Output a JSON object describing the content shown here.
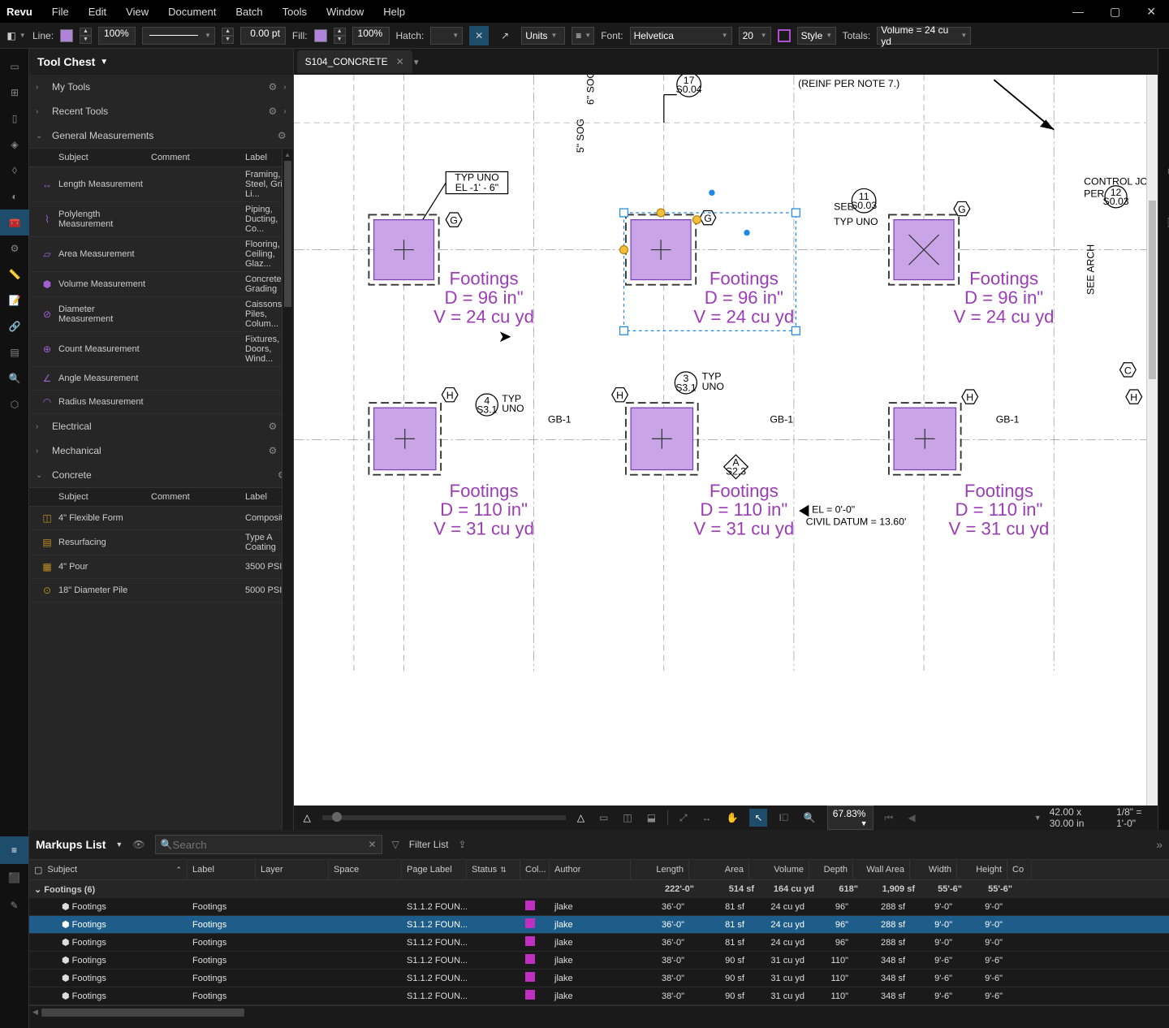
{
  "app": {
    "name": "Revu"
  },
  "menu": [
    "File",
    "Edit",
    "View",
    "Document",
    "Batch",
    "Tools",
    "Window",
    "Help"
  ],
  "toolbar": {
    "line_label": "Line:",
    "line_swatch": "#b083d8",
    "line_pct": "100%",
    "thickness": "0.00 pt",
    "fill_label": "Fill:",
    "fill_swatch": "#b083d8",
    "fill_pct": "100%",
    "hatch_label": "Hatch:",
    "units_label": "Units",
    "font_label": "Font:",
    "font_value": "Helvetica",
    "font_size": "20",
    "style_label": "Style",
    "totals_label": "Totals:",
    "totals_value": "Volume = 24 cu yd"
  },
  "tool_chest": {
    "title": "Tool Chest",
    "sections": {
      "my_tools": "My Tools",
      "recent_tools": "Recent Tools",
      "general": "General Measurements",
      "electrical": "Electrical",
      "mechanical": "Mechanical",
      "concrete": "Concrete"
    },
    "cols": {
      "subject": "Subject",
      "comment": "Comment",
      "label": "Label"
    },
    "general_rows": [
      {
        "subject": "Length Measurement",
        "label": "Framing, Steel, Grid Li..."
      },
      {
        "subject": "Polylength Measurement",
        "label": "Piping, Ducting, Co..."
      },
      {
        "subject": "Area Measurement",
        "label": "Flooring, Ceiling, Glaz..."
      },
      {
        "subject": "Volume Measurement",
        "label": "Concrete, Grading"
      },
      {
        "subject": "Diameter Measurement",
        "label": "Caissons, Piles, Colum..."
      },
      {
        "subject": "Count Measurement",
        "label": "Fixtures, Doors, Wind..."
      },
      {
        "subject": "Angle Measurement",
        "label": ""
      },
      {
        "subject": "Radius Measurement",
        "label": ""
      }
    ],
    "concrete_rows": [
      {
        "subject": "4\" Flexible Form",
        "label": "Composite"
      },
      {
        "subject": "Resurfacing",
        "label": "Type A Coating"
      },
      {
        "subject": "4\" Pour",
        "label": "3500 PSI"
      },
      {
        "subject": "18\" Diameter Pile",
        "label": "5000 PSI"
      }
    ]
  },
  "document": {
    "tab_name": "S104_CONCRETE",
    "reinf_note": "(REINF PER NOTE 7.)",
    "typ_uno": "TYP UNO",
    "el_note": "EL -1' - 6\"",
    "see": "SEE",
    "callout_11": "11",
    "callout_11_sub": "S0.03",
    "callout_17": "17",
    "callout_17_sub": "S0.04",
    "callout_12": "12",
    "callout_12_sub": "S0.03",
    "callout_3": "3",
    "callout_3_sub": "S3.1",
    "callout_4": "4",
    "callout_4_sub": "S3.1",
    "typ": "TYP",
    "uno": "UNO",
    "gb1": "GB-1",
    "see_arch": "SEE ARCH",
    "control_joint": "CONTROL JOI",
    "per": "PER",
    "el_datum": "EL = 0'-0\"",
    "civil_datum": "CIVIL DATUM = 13.60'",
    "sog1": "6\" SOG",
    "sog2": "5\" SOG",
    "g_label": "G",
    "h_label": "H",
    "c_label": "C",
    "a_label": "A",
    "callout_a": "A",
    "callout_a_sub": "S2.3",
    "footings_top": [
      {
        "title": "Footings",
        "d": "D = 96 in\"",
        "v": "V = 24 cu yd"
      },
      {
        "title": "Footings",
        "d": "D = 96 in\"",
        "v": "V = 24 cu yd"
      },
      {
        "title": "Footings",
        "d": "D = 96 in\"",
        "v": "V = 24 cu yd"
      }
    ],
    "footings_bot": [
      {
        "title": "Footings",
        "d": "D = 110 in\"",
        "v": "V = 31 cu yd"
      },
      {
        "title": "Footings",
        "d": "D = 110 in\"",
        "v": "V = 31 cu yd"
      },
      {
        "title": "Footings",
        "d": "D = 110 in\"",
        "v": "V = 31 cu yd"
      }
    ]
  },
  "bottombar": {
    "zoom": "67.83%",
    "dims": "42.00 x 30.00 in",
    "scale": "1/8\" = 1'-0\"",
    "tri_left": "△",
    "tri_right": "△"
  },
  "markups": {
    "title": "Markups List",
    "search_placeholder": "Search",
    "filter": "Filter List",
    "cols": {
      "subject": "Subject",
      "label": "Label",
      "layer": "Layer",
      "space": "Space",
      "page": "Page Label",
      "status": "Status",
      "color": "Col...",
      "author": "Author",
      "length": "Length",
      "area": "Area",
      "volume": "Volume",
      "depth": "Depth",
      "wall": "Wall Area",
      "width": "Width",
      "height": "Height",
      "extra": "Co"
    },
    "group": {
      "name": "Footings (6)",
      "length": "222'-0\"",
      "area": "514 sf",
      "volume": "164 cu yd",
      "depth": "618\"",
      "wall": "1,909 sf",
      "width": "55'-6\"",
      "height": "55'-6\""
    },
    "rows": [
      {
        "subject": "Footings",
        "label": "Footings",
        "page": "S1.1.2 FOUN...",
        "color": "#c030c0",
        "author": "jlake",
        "length": "36'-0\"",
        "area": "81 sf",
        "volume": "24 cu yd",
        "depth": "96\"",
        "wall": "288 sf",
        "width": "9'-0\"",
        "height": "9'-0\"",
        "selected": false
      },
      {
        "subject": "Footings",
        "label": "Footings",
        "page": "S1.1.2 FOUN...",
        "color": "#c030c0",
        "author": "jlake",
        "length": "36'-0\"",
        "area": "81 sf",
        "volume": "24 cu yd",
        "depth": "96\"",
        "wall": "288 sf",
        "width": "9'-0\"",
        "height": "9'-0\"",
        "selected": true
      },
      {
        "subject": "Footings",
        "label": "Footings",
        "page": "S1.1.2 FOUN...",
        "color": "#c030c0",
        "author": "jlake",
        "length": "36'-0\"",
        "area": "81 sf",
        "volume": "24 cu yd",
        "depth": "96\"",
        "wall": "288 sf",
        "width": "9'-0\"",
        "height": "9'-0\"",
        "selected": false
      },
      {
        "subject": "Footings",
        "label": "Footings",
        "page": "S1.1.2 FOUN...",
        "color": "#c030c0",
        "author": "jlake",
        "length": "38'-0\"",
        "area": "90 sf",
        "volume": "31 cu yd",
        "depth": "110\"",
        "wall": "348 sf",
        "width": "9'-6\"",
        "height": "9'-6\"",
        "selected": false
      },
      {
        "subject": "Footings",
        "label": "Footings",
        "page": "S1.1.2 FOUN...",
        "color": "#c030c0",
        "author": "jlake",
        "length": "38'-0\"",
        "area": "90 sf",
        "volume": "31 cu yd",
        "depth": "110\"",
        "wall": "348 sf",
        "width": "9'-6\"",
        "height": "9'-6\"",
        "selected": false
      },
      {
        "subject": "Footings",
        "label": "Footings",
        "page": "S1.1.2 FOUN...",
        "color": "#c030c0",
        "author": "jlake",
        "length": "38'-0\"",
        "area": "90 sf",
        "volume": "31 cu yd",
        "depth": "110\"",
        "wall": "348 sf",
        "width": "9'-6\"",
        "height": "9'-6\"",
        "selected": false
      }
    ]
  }
}
